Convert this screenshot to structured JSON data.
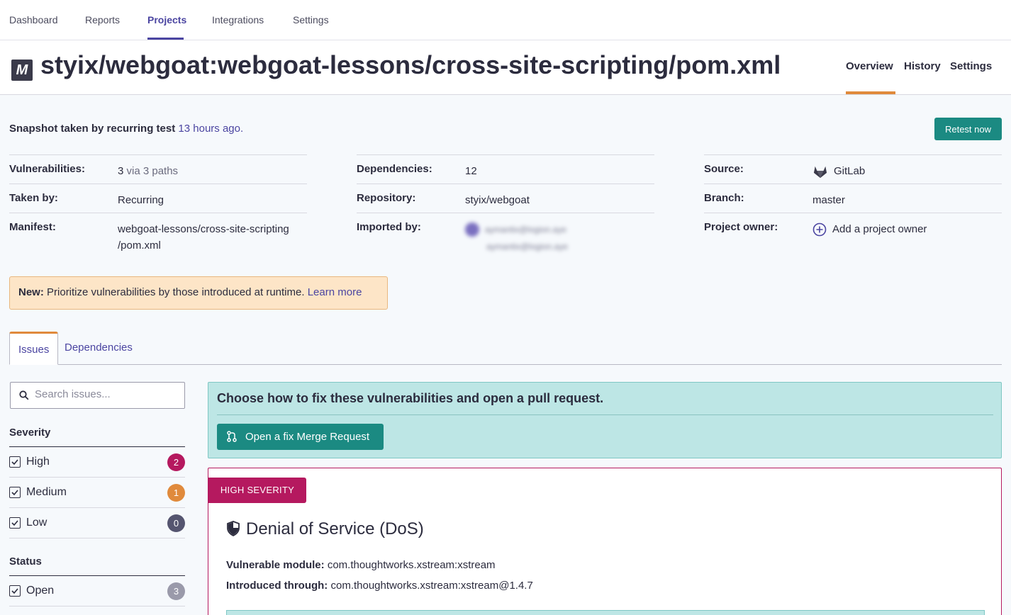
{
  "topnav": {
    "items": [
      {
        "label": "Dashboard"
      },
      {
        "label": "Reports"
      },
      {
        "label": "Projects"
      },
      {
        "label": "Integrations"
      },
      {
        "label": "Settings"
      }
    ],
    "active": "Projects"
  },
  "header": {
    "logo": "M",
    "title": "styix/webgoat:webgoat-lessons/cross-site-scripting/pom.xml",
    "tabs": [
      {
        "label": "Overview"
      },
      {
        "label": "History"
      },
      {
        "label": "Settings"
      }
    ],
    "active_tab": "Overview"
  },
  "snapshot": {
    "prefix": "Snapshot taken by recurring test",
    "time": "13 hours ago.",
    "retest_label": "Retest now"
  },
  "info": {
    "vulnerabilities_label": "Vulnerabilities:",
    "vulnerabilities_count": "3",
    "vulnerabilities_paths": "via 3 paths",
    "taken_by_label": "Taken by:",
    "taken_by_value": "Recurring",
    "manifest_label": "Manifest:",
    "manifest_line1": "webgoat-lessons/cross-site-scripting",
    "manifest_line2": "/pom.xml",
    "dependencies_label": "Dependencies:",
    "dependencies_value": "12",
    "repository_label": "Repository:",
    "repository_value": "styix/webgoat",
    "imported_by_label": "Imported by:",
    "imported_by_name": "aymantix@logion.aye",
    "imported_by_email": "aymantix@logion.aye",
    "source_label": "Source:",
    "source_value": "GitLab",
    "branch_label": "Branch:",
    "branch_value": "master",
    "owner_label": "Project owner:",
    "owner_action": "Add a project owner"
  },
  "notice": {
    "prefix": "New:",
    "text": "Prioritize vulnerabilities by those introduced at runtime.",
    "link": "Learn more"
  },
  "tabs": [
    {
      "label": "Issues"
    },
    {
      "label": "Dependencies"
    }
  ],
  "search": {
    "placeholder": "Search issues..."
  },
  "filters": {
    "severity_heading": "Severity",
    "severity": [
      {
        "label": "High",
        "count": "2",
        "color": "#b5195f"
      },
      {
        "label": "Medium",
        "count": "1",
        "color": "#e08a3c"
      },
      {
        "label": "Low",
        "count": "0",
        "color": "#555570"
      }
    ],
    "status_heading": "Status",
    "status": [
      {
        "label": "Open",
        "count": "3",
        "color": "#9a9aaa"
      }
    ]
  },
  "fix": {
    "title": "Choose how to fix these vulnerabilities and open a pull request.",
    "button": "Open a fix Merge Request"
  },
  "issue": {
    "severity_tag": "HIGH SEVERITY",
    "title": "Denial of Service (DoS)",
    "module_label": "Vulnerable module:",
    "module_value": "com.thoughtworks.xstream:xstream",
    "introduced_label": "Introduced through:",
    "introduced_value": "com.thoughtworks.xstream:xstream@1.4.7"
  },
  "colors": {
    "accent": "#4b45a1",
    "teal": "#1b8a82",
    "high": "#b5195f",
    "medium": "#e08a3c"
  }
}
